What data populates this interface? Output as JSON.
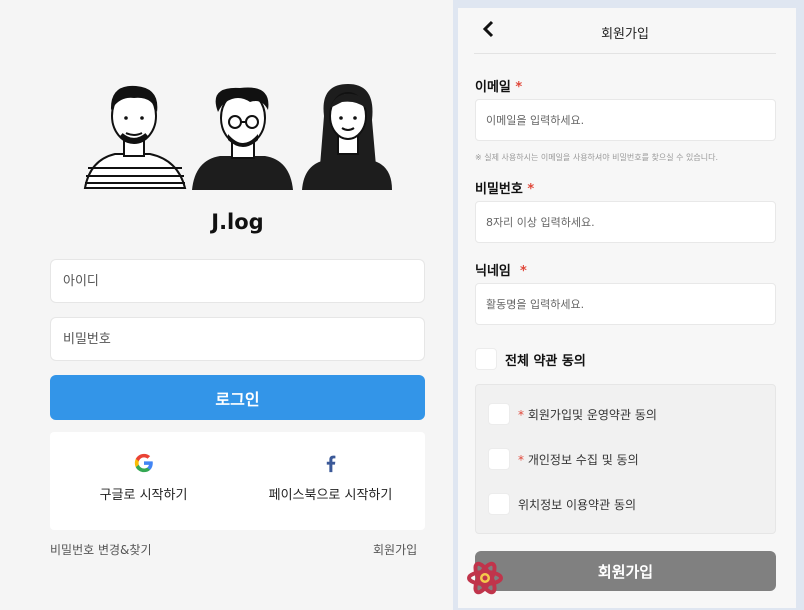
{
  "login": {
    "brand": "J.log",
    "id_placeholder": "아이디",
    "pw_placeholder": "비밀번호",
    "login_label": "로그인",
    "google_label": "구글로 시작하기",
    "facebook_label": "페이스북으로 시작하기",
    "find_pw_label": "비밀번호 변경&찾기",
    "signup_link_label": "회원가입"
  },
  "signup": {
    "back_icon": "chevron-left",
    "title": "회원가입",
    "email_label": "이메일",
    "email_placeholder": "이메일을 입력하세요.",
    "email_note": "※ 실제 사용하시는 이메일을 사용하셔야 비밀번호를 찾으실 수 있습니다.",
    "password_label": "비밀번호",
    "password_placeholder": "8자리 이상 입력하세요.",
    "nickname_label": "닉네임",
    "nickname_placeholder": "활동명을 입력하세요.",
    "required_mark": "*",
    "agree_all_label": "전체 약관 동의",
    "terms": [
      {
        "label": "회원가입및 운영약관 동의",
        "required": "*"
      },
      {
        "label": "개인정보 수집 및 동의",
        "required": "*"
      },
      {
        "label": "위치정보 이용약관 동의",
        "required": ""
      }
    ],
    "submit_label": "회원가입"
  },
  "colors": {
    "primary": "#3395e8",
    "required": "#e0483a",
    "submit_disabled": "#808080"
  }
}
